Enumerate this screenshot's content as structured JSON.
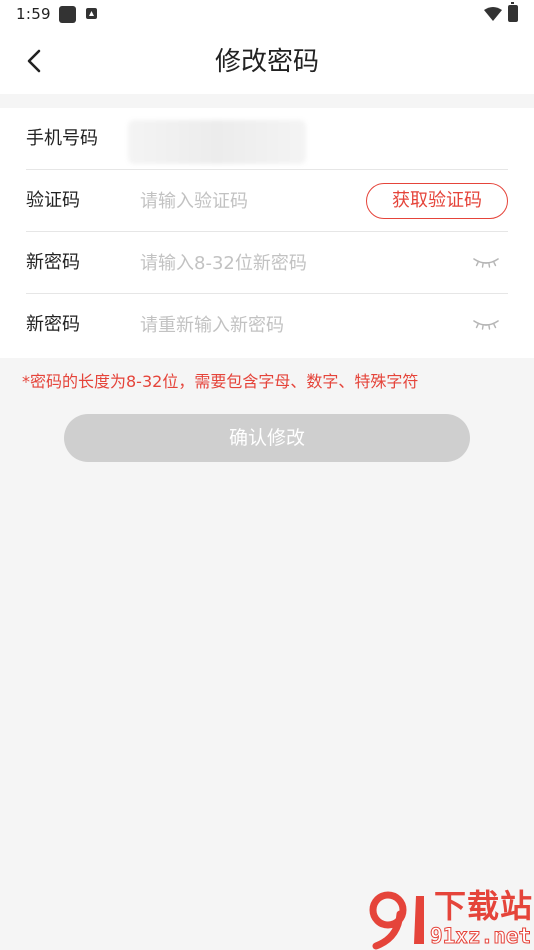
{
  "status_bar": {
    "time": "1:59",
    "icons": [
      "app-square-icon",
      "app-a-icon",
      "wifi-icon",
      "battery-charging-icon"
    ]
  },
  "header": {
    "title": "修改密码",
    "back_icon": "chevron-left-icon"
  },
  "form": {
    "phone": {
      "label": "手机号码",
      "value": ""
    },
    "code": {
      "label": "验证码",
      "placeholder": "请输入验证码",
      "button_label": "获取验证码"
    },
    "new_password": {
      "label": "新密码",
      "placeholder": "请输入8-32位新密码",
      "toggle_icon": "eye-closed-icon"
    },
    "confirm_password": {
      "label": "新密码",
      "placeholder": "请重新输入新密码",
      "toggle_icon": "eye-closed-icon"
    }
  },
  "hint": "*密码的长度为8-32位，需要包含字母、数字、特殊字符",
  "confirm_button": "确认修改",
  "watermark": {
    "title": "下载站",
    "url": "91xz.net"
  },
  "colors": {
    "accent": "#e5443a",
    "background": "#f5f5f5",
    "button_disabled": "#cfcfcf",
    "placeholder": "#c2c2c2"
  }
}
